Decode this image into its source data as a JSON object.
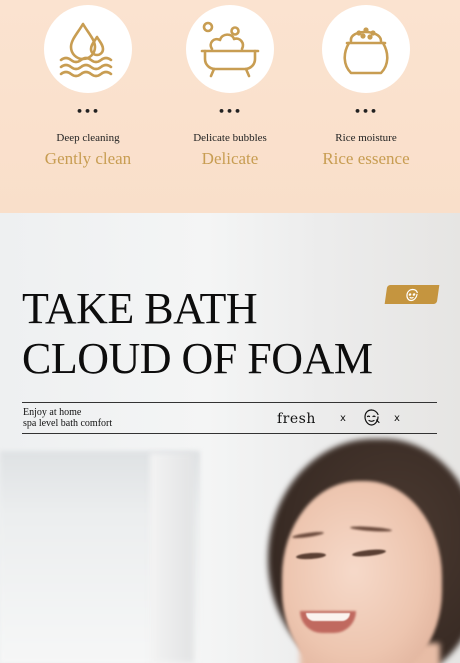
{
  "features": [
    {
      "icon": "water-drops-waves-icon",
      "dots": "•••",
      "label": "Deep cleaning",
      "tagline": "Gently clean"
    },
    {
      "icon": "bathtub-bubbles-icon",
      "dots": "•••",
      "label": "Delicate bubbles",
      "tagline": "Delicate"
    },
    {
      "icon": "rice-sack-icon",
      "dots": "•••",
      "label": "Rice moisture",
      "tagline": "Rice essence"
    }
  ],
  "hero": {
    "title_line1": "TAKE BATH",
    "title_line2": "CLOUD OF FOAM",
    "subtitle_line1": "Enjoy at home",
    "subtitle_line2": "spa level bath comfort",
    "fresh": "fresh",
    "x1": "x",
    "x2": "x"
  },
  "colors": {
    "peach_bg": "#fbe3d0",
    "gold": "#c89d52",
    "badge_gold": "#c5953f",
    "text_dark": "#0d0d0d"
  }
}
